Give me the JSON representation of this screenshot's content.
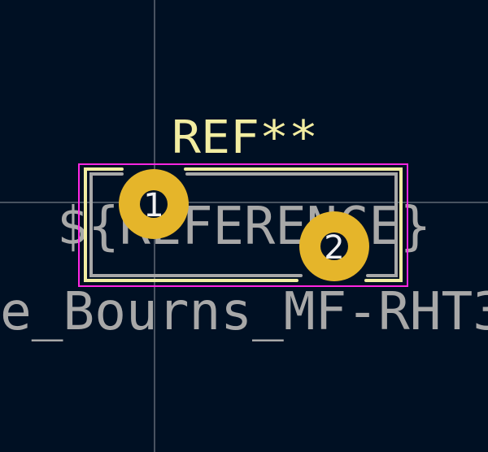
{
  "footprint": {
    "reference": "REF**",
    "reference_placeholder": "${REFERENCE}",
    "value": "e_Bourns_MF-RHT3",
    "pads": [
      {
        "number": "1"
      },
      {
        "number": "2"
      }
    ]
  },
  "colors": {
    "background": "#001023",
    "crosshair": "#8f949c",
    "courtyard": "#ff26e2",
    "silkscreen": "#f2eda1",
    "fab_text": "#a8a8a8",
    "pad": "#e5b52a",
    "pad_number": "#f0f0f0"
  }
}
